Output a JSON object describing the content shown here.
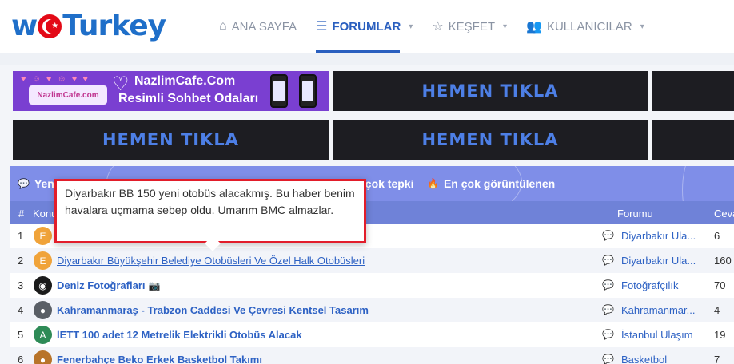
{
  "brand": {
    "logo_w": "w",
    "logo_rest": "Turkey"
  },
  "nav": [
    {
      "icon": "home-icon",
      "glyph": "⌂",
      "label": "ANA SAYFA",
      "caret": ""
    },
    {
      "icon": "forum-icon",
      "glyph": "☰",
      "label": "FORUMLAR",
      "caret": "▾"
    },
    {
      "icon": "star-icon",
      "glyph": "☆",
      "label": "KEŞFET",
      "caret": "▾"
    },
    {
      "icon": "users-icon",
      "glyph": "👥",
      "label": "KULLANICILAR",
      "caret": "▾"
    }
  ],
  "banners": {
    "cafe_line1": "NazlimCafe.Com",
    "cafe_line2": "Resimli Sohbet Odaları",
    "cafe_logo": "NazlimCafe.com",
    "cta": "HEMEN TIKLA"
  },
  "tabs": {
    "new": "Yeni",
    "reactions": "En çok tepki",
    "views": "En çok görüntülenen"
  },
  "columns": {
    "hash": "#",
    "topic": "Konu",
    "forum": "Forumu",
    "count": "Ceva"
  },
  "tooltip": "Diyarbakır BB 150 yeni otobüs alacakmış. Bu haber benim havalara uçmama sebep oldu. Umarım BMC almazlar.",
  "rows": [
    {
      "num": "1",
      "avatar": "E",
      "avatar_color": "#f0a33a",
      "title": "",
      "forum": "Diyarbakır Ula...",
      "count": "6"
    },
    {
      "num": "2",
      "avatar": "E",
      "avatar_color": "#f0a33a",
      "title": "Diyarbakır Büyükşehir Belediye Otobüsleri Ve Özel Halk Otobüsleri",
      "forum": "Diyarbakır Ula...",
      "count": "160"
    },
    {
      "num": "3",
      "avatar": "",
      "avatar_color": "#1b1b1b",
      "title": "Deniz Fotoğrafları",
      "badge": "📷",
      "forum": "Fotoğrafçılık",
      "count": "70"
    },
    {
      "num": "4",
      "avatar": "",
      "avatar_color": "#5a5f66",
      "title": "Kahramanmaraş - Trabzon Caddesi Ve Çevresi Kentsel Tasarım",
      "forum": "Kahramanmar...",
      "count": "4"
    },
    {
      "num": "5",
      "avatar": "A",
      "avatar_color": "#2e8b57",
      "title": "İETT 100 adet 12 Metrelik Elektrikli Otobüs Alacak",
      "forum": "İstanbul Ulaşım",
      "count": "19"
    },
    {
      "num": "6",
      "avatar": "",
      "avatar_color": "#b8742a",
      "title": "Fenerbahçe Beko Erkek Basketbol Takımı",
      "forum": "Basketbol",
      "count": "7"
    }
  ]
}
